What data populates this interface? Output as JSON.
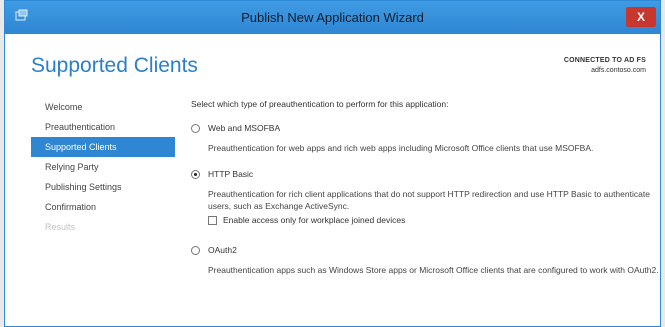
{
  "window": {
    "title": "Publish New Application Wizard",
    "close_label": "X"
  },
  "header": {
    "title": "Supported Clients",
    "connection_status": "CONNECTED TO AD FS",
    "server": "adfs.contoso.com"
  },
  "nav": {
    "items": [
      {
        "label": "Welcome"
      },
      {
        "label": "Preauthentication"
      },
      {
        "label": "Supported Clients"
      },
      {
        "label": "Relying Party"
      },
      {
        "label": "Publishing Settings"
      },
      {
        "label": "Confirmation"
      },
      {
        "label": "Results"
      }
    ]
  },
  "content": {
    "prompt": "Select which type of preauthentication to perform for this application:",
    "options": [
      {
        "label": "Web and MSOFBA",
        "description": "Preauthentication for web apps and rich web apps including Microsoft Office clients that use MSOFBA.",
        "selected": false
      },
      {
        "label": "HTTP Basic",
        "description": "Preauthentication for rich client applications that do not support HTTP redirection and use HTTP Basic to authenticate users, such as Exchange ActiveSync.",
        "selected": true,
        "checkbox_label": "Enable access only for workplace joined devices",
        "checkbox_checked": false
      },
      {
        "label": "OAuth2",
        "description": "Preauthentication apps such as Windows Store apps or Microsoft Office clients that are configured to work with OAuth2.",
        "selected": false
      }
    ]
  },
  "colors": {
    "accent": "#2f86d3",
    "title_text": "#2b7fc9",
    "close": "#c7372f"
  }
}
